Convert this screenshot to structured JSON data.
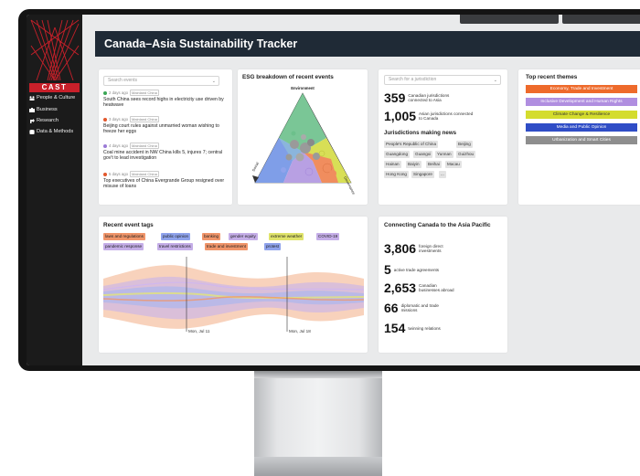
{
  "app": {
    "logo_text": "CAST",
    "title": "Canada–Asia Sustainability Tracker"
  },
  "sidebar": {
    "items": [
      {
        "label": "People & Culture",
        "icon": "people-icon"
      },
      {
        "label": "Business",
        "icon": "business-icon"
      },
      {
        "label": "Research",
        "icon": "research-icon"
      },
      {
        "label": "Data & Methods",
        "icon": "database-icon"
      }
    ]
  },
  "events": {
    "search_placeholder": "Search events",
    "items": [
      {
        "date": "2 days ago",
        "location": "Mainland China",
        "dot_color": "#3aa655",
        "text": "South China sees record highs in electricity use driven by heatwave"
      },
      {
        "date": "3 days ago",
        "location": "Mainland China",
        "dot_color": "#e2572c",
        "text": "Beijing court rules against unmarried woman wishing to freeze her eggs"
      },
      {
        "date": "4 days ago",
        "location": "Mainland China",
        "dot_color": "#9a7ad6",
        "text": "Coal mine accident in NW China kills 5, injures 7; central gov't to lead investigation"
      },
      {
        "date": "5 days ago",
        "location": "Mainland China",
        "dot_color": "#e2572c",
        "text": "Top executives of China Evergrande Group resigned over misuse of loans"
      }
    ]
  },
  "esg": {
    "title": "ESG breakdown of recent events",
    "label_top": "Environment",
    "label_left": "Social",
    "label_right": "Governance"
  },
  "jurisdictions": {
    "search_placeholder": "Search for a jurisdiction",
    "stat1_value": "359",
    "stat1_label": "Canadian jurisdictions connected to Asia",
    "stat2_value": "1,005",
    "stat2_label": "Asian jurisdictions connected to Canada",
    "news_title": "Jurisdictions making news",
    "chips": [
      "People's Republic of China",
      "Beijing",
      "Guangdong",
      "Guangxi",
      "Yunnan",
      "Guizhou",
      "Hainan",
      "Baiyin",
      "Beihai",
      "Macau",
      "Hong Kong",
      "Singapore",
      "..."
    ]
  },
  "themes": {
    "title": "Top recent themes",
    "items": [
      {
        "label": "Economy, Trade and Investment",
        "bg": "#ee6a2b",
        "fg": "#ffffff"
      },
      {
        "label": "Inclusive Development and Human Rights",
        "bg": "#b08ee0",
        "fg": "#ffffff"
      },
      {
        "label": "Climate Change & Resilience",
        "bg": "#d4dc2e",
        "fg": "#333333"
      },
      {
        "label": "Media and Public Opinion",
        "bg": "#2f4dc6",
        "fg": "#ffffff"
      },
      {
        "label": "Urbanization and Smart Cities",
        "bg": "#8e8e8e",
        "fg": "#ffffff"
      }
    ]
  },
  "tags": {
    "title": "Recent event tags",
    "items": [
      {
        "label": "laws and regulations",
        "bg": "#f0956a"
      },
      {
        "label": "public opinion",
        "bg": "#8fa3ec"
      },
      {
        "label": "banking",
        "bg": "#f0956a"
      },
      {
        "label": "gender equity",
        "bg": "#c5aee8"
      },
      {
        "label": "extreme weather",
        "bg": "#dfe36a"
      },
      {
        "label": "COVID-19",
        "bg": "#c5aee8"
      },
      {
        "label": "pandemic response",
        "bg": "#c5aee8"
      },
      {
        "label": "travel restrictions",
        "bg": "#c5aee8"
      },
      {
        "label": "trade and investment",
        "bg": "#f0956a"
      },
      {
        "label": "protest",
        "bg": "#8fa3ec"
      }
    ],
    "marker1": "Mon, Jul 11",
    "marker2": "Mon, Jul 18"
  },
  "connecting": {
    "title": "Connecting Canada to the Asia Pacific",
    "stats": [
      {
        "value": "3,806",
        "label": "foreign direct investments"
      },
      {
        "value": "5",
        "label": "active trade agreements"
      },
      {
        "value": "2,653",
        "label": "Canadian businesses abroad"
      },
      {
        "value": "66",
        "label": "diplomatic and trade missions"
      },
      {
        "value": "154",
        "label": "twinning relations"
      }
    ]
  }
}
